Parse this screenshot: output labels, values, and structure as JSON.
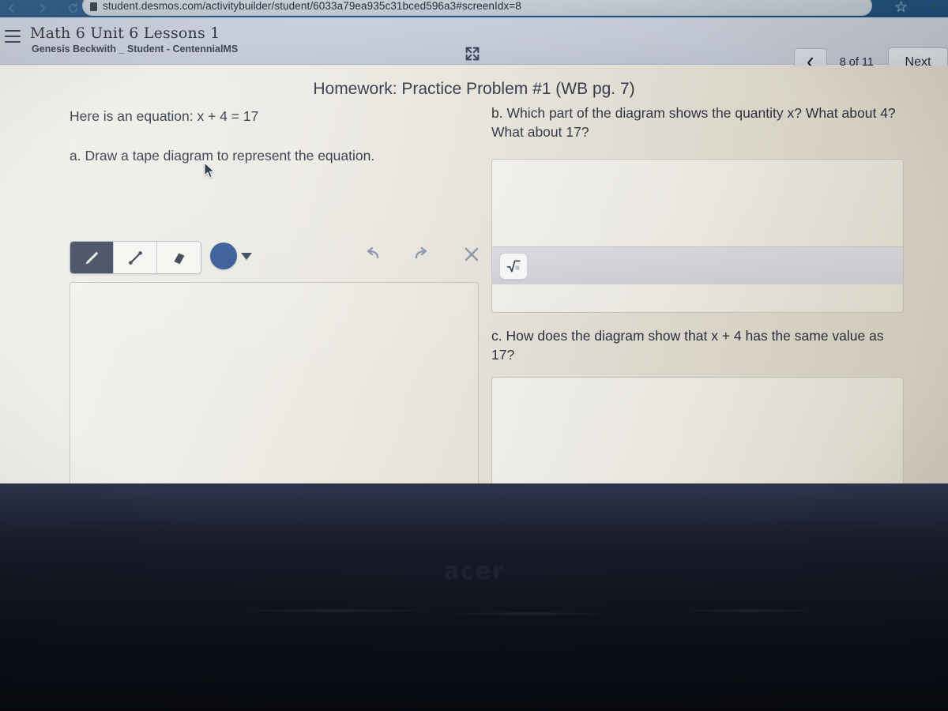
{
  "browser": {
    "url": "student.desmos.com/activitybuilder/student/6033a79ea935c31bced596a3#screenIdx=8",
    "back_icon": "back-arrow-icon",
    "forward_icon": "forward-arrow-icon",
    "reload_icon": "reload-icon",
    "lock_icon": "lock-icon",
    "bookmark_icon": "star-icon",
    "extensions_icon": "puzzle-icon"
  },
  "header": {
    "menu_icon": "hamburger-menu-icon",
    "title": "Math 6 Unit 6 Lessons 1",
    "subtitle": "Genesis Beckwith _ Student - CentennialMS",
    "expand_icon": "fullscreen-expand-icon",
    "back_icon": "chevron-left-icon",
    "page_indicator": "8 of 11",
    "next_label": "Next"
  },
  "screen_content": {
    "title": "Homework: Practice Problem #1 (WB pg. 7)",
    "left": {
      "prompt": "Here is an equation: x + 4 = 17",
      "part_a": "a. Draw a tape diagram to represent the equation."
    },
    "right": {
      "part_b": "b. Which part of the diagram shows the quantity x? What about 4? What about 17?",
      "part_c": "c. How does the diagram show that x + 4 has the same value as 17?",
      "answer_b_value": "",
      "answer_b_placeholder": "",
      "answer_c_value": "",
      "answer_c_placeholder": "",
      "math_button_icon": "square-root-icon"
    }
  },
  "drawing_toolbar": {
    "tools": [
      {
        "name": "pencil-tool",
        "icon": "pencil-icon",
        "active": true
      },
      {
        "name": "line-tool",
        "icon": "line-segment-icon",
        "active": false
      },
      {
        "name": "eraser-tool",
        "icon": "eraser-icon",
        "active": false
      }
    ],
    "color": "#2f5692",
    "color_dropdown_icon": "chevron-down-icon",
    "undo_icon": "undo-arrow-icon",
    "redo_icon": "redo-arrow-icon",
    "clear_icon": "close-x-icon"
  },
  "shelf": {
    "apps": [
      {
        "name": "chrome",
        "icon": "chrome-icon",
        "active": true
      },
      {
        "name": "gmail",
        "icon": "gmail-icon",
        "active": false
      },
      {
        "name": "google-docs",
        "icon": "docs-icon",
        "active": false
      }
    ],
    "status": {
      "wifi_icon": "wifi-icon",
      "battery_icon": "battery-icon"
    }
  },
  "device": {
    "brand": "acer"
  },
  "colors": {
    "browser_chrome": "#1d4f7e",
    "header_bar": "#c7cedb",
    "page_bg": "#ece9e2",
    "text": "#262e3e",
    "pen_color": "#2f5692",
    "tool_active_bg": "#3d4659",
    "shelf_bg": "#161a28"
  }
}
